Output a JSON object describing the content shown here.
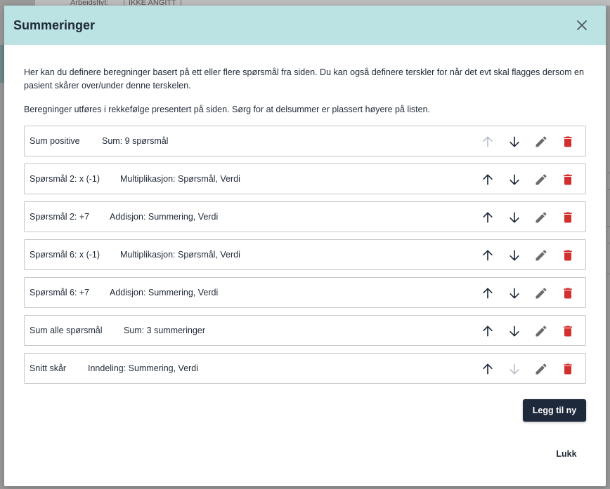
{
  "background": {
    "ghost_label_a": "Arbeidsflyt:",
    "ghost_label_b": "IKKE ANGITT"
  },
  "modal": {
    "title": "Summeringer",
    "intro": "Her kan du definere beregninger basert på ett eller flere spørsmål fra siden. Du kan også definere terskler for når det evt skal flagges dersom en pasient skårer over/under denne terskelen.",
    "intro2": "Beregninger utføres i rekkefølge presentert på siden. Sørg for at delsummer er plassert høyere på listen.",
    "rows": [
      {
        "name": "Sum positive",
        "operation": "Sum:  9 spørsmål",
        "up_enabled": false,
        "down_enabled": true
      },
      {
        "name": "Spørsmål 2: x (-1)",
        "operation": "Multiplikasjon:  Spørsmål, Verdi",
        "up_enabled": true,
        "down_enabled": true
      },
      {
        "name": "Spørsmål 2: +7",
        "operation": "Addisjon:  Summering, Verdi",
        "up_enabled": true,
        "down_enabled": true
      },
      {
        "name": "Spørsmål 6: x (-1)",
        "operation": "Multiplikasjon:  Spørsmål, Verdi",
        "up_enabled": true,
        "down_enabled": true
      },
      {
        "name": "Spørsmål 6: +7",
        "operation": "Addisjon:  Summering, Verdi",
        "up_enabled": true,
        "down_enabled": true
      },
      {
        "name": "Sum alle spørsmål",
        "operation": "Sum:  3 summeringer",
        "up_enabled": true,
        "down_enabled": true
      },
      {
        "name": "Snitt skår",
        "operation": "Inndeling:  Summering, Verdi",
        "up_enabled": true,
        "down_enabled": false
      }
    ],
    "add_button_label": "Legg til ny",
    "close_button_label": "Lukk"
  },
  "icons": {
    "close": "close-icon",
    "up": "arrow-up-icon",
    "down": "arrow-down-icon",
    "edit": "pencil-icon",
    "delete": "trash-icon"
  },
  "colors": {
    "header_bg": "#bbe3e3",
    "primary_button": "#1e293b",
    "delete_icon": "#d32f2f",
    "edit_icon": "#6b6b6b",
    "arrow_enabled": "#1f2937",
    "arrow_disabled": "#b9bfc6"
  }
}
